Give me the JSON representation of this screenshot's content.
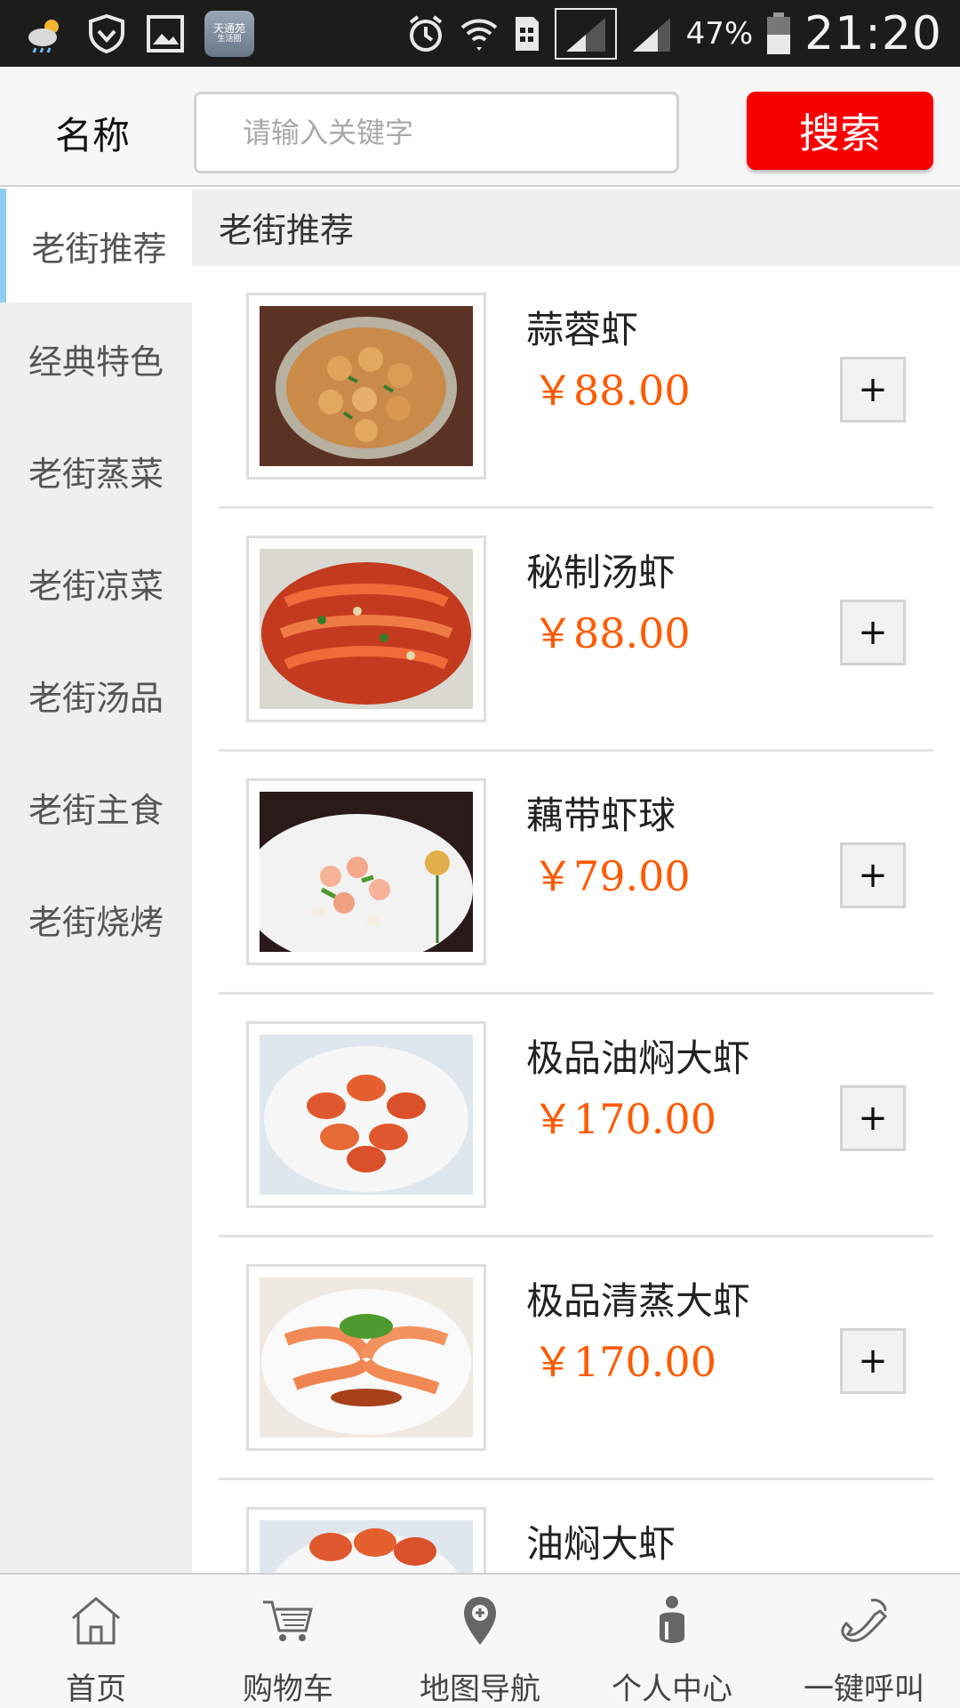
{
  "status_bar": {
    "app_chip_line1": "天通苑",
    "app_chip_line2": "生活圈",
    "battery_pct": "47%",
    "time": "21:20"
  },
  "search": {
    "label": "名称",
    "placeholder": "请输入关键字",
    "button_label": "搜索"
  },
  "sidebar": {
    "items": [
      {
        "label": "老街推荐"
      },
      {
        "label": "经典特色"
      },
      {
        "label": "老街蒸菜"
      },
      {
        "label": "老街凉菜"
      },
      {
        "label": "老街汤品"
      },
      {
        "label": "老街主食"
      },
      {
        "label": "老街烧烤"
      }
    ]
  },
  "main": {
    "section_title": "老街推荐",
    "add_label": "+",
    "dishes": [
      {
        "name": "蒜蓉虾",
        "price": "￥88.00"
      },
      {
        "name": "秘制汤虾",
        "price": "￥88.00"
      },
      {
        "name": "藕带虾球",
        "price": "￥79.00"
      },
      {
        "name": "极品油焖大虾",
        "price": "￥170.00"
      },
      {
        "name": "极品清蒸大虾",
        "price": "￥170.00"
      },
      {
        "name": "油焖大虾",
        "price": ""
      }
    ]
  },
  "bottom_nav": {
    "items": [
      {
        "label": "首页",
        "icon": "home-icon"
      },
      {
        "label": "购物车",
        "icon": "cart-icon"
      },
      {
        "label": "地图导航",
        "icon": "map-pin-icon"
      },
      {
        "label": "个人中心",
        "icon": "person-icon"
      },
      {
        "label": "一键呼叫",
        "icon": "phone-icon"
      }
    ]
  },
  "colors": {
    "accent_red": "#fb0000",
    "price_orange": "#ff5a00",
    "active_indicator": "#8fcdf5"
  }
}
